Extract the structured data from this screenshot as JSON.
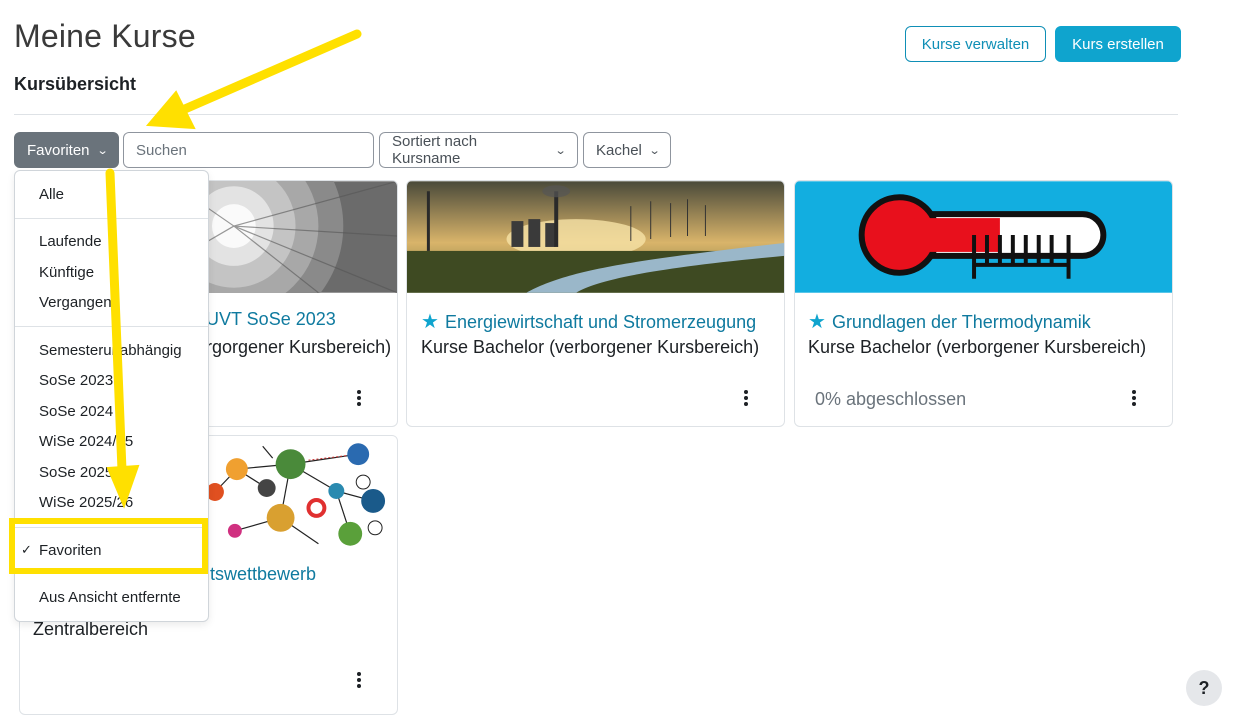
{
  "page_title": "Meine Kurse",
  "header_buttons": {
    "manage": "Kurse verwalten",
    "create": "Kurs erstellen"
  },
  "section_title": "Kursübersicht",
  "controls": {
    "grouping": "Favoriten",
    "search_placeholder": "Suchen",
    "sort": "Sortiert nach Kursname",
    "view": "Kachel"
  },
  "dropdown": {
    "items": [
      "Alle",
      "Laufende",
      "Künftige",
      "Vergangene",
      "Semesterunabhängig",
      "SoSe 2023",
      "SoSe 2024",
      "WiSe 2024/25",
      "SoSe 2025",
      "WiSe 2025/26",
      "Favoriten",
      "Aus Ansicht entfernte"
    ],
    "selected": "Favoriten"
  },
  "courses": [
    {
      "title": "UVT SoSe 2023",
      "category": "rgorgener Kursbereich)",
      "favourite": false,
      "progress": ""
    },
    {
      "title": "Energiewirtschaft und Stromerzeugung",
      "category": "Kurse Bachelor (verborgener Kursbereich)",
      "favourite": true,
      "progress": ""
    },
    {
      "title": "Grundlagen der Thermodynamik",
      "category": "Kurse Bachelor (verborgener Kursbereich)",
      "favourite": true,
      "progress": "0% abgeschlossen"
    },
    {
      "title": "itswettbewerb",
      "category": "Zentralbereich",
      "favourite": false,
      "progress": ""
    }
  ],
  "help_label": "?",
  "colors": {
    "accent": "#0fa4ce",
    "link": "#0f7a9f",
    "highlight": "#ffe000",
    "thermo_bg": "#12aee0",
    "thermo_red": "#e8101c"
  }
}
